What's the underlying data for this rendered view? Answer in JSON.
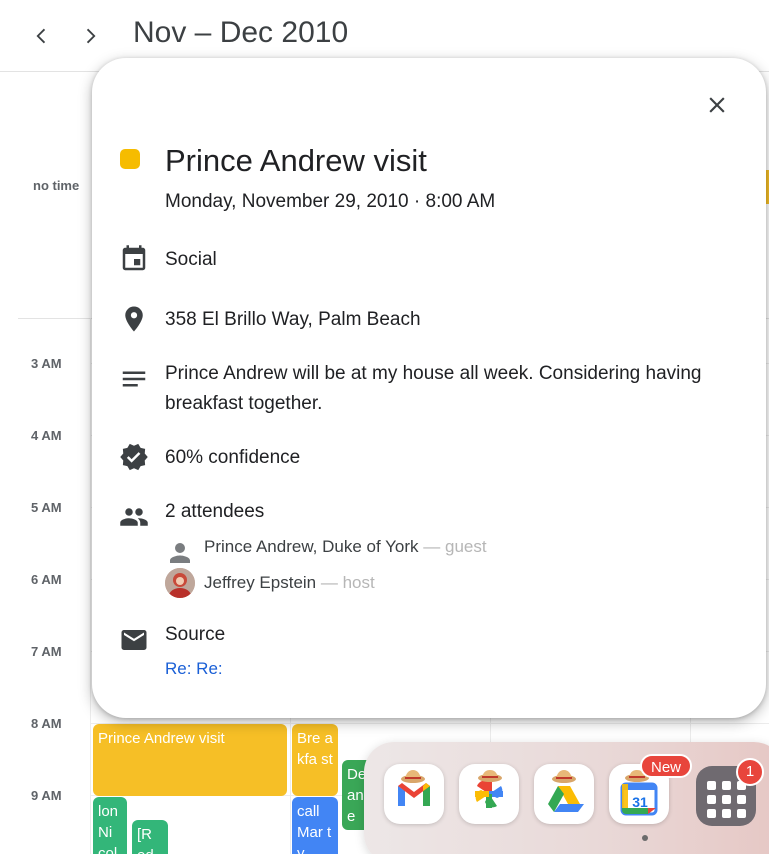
{
  "header": {
    "prev_icon": "chevron-left-icon",
    "next_icon": "chevron-right-icon",
    "range_title": "Nov – Dec 2010"
  },
  "grid": {
    "no_time_label": "no time",
    "hours": [
      "3 AM",
      "4 AM",
      "5 AM",
      "6 AM",
      "7 AM",
      "8 AM",
      "9 AM"
    ],
    "events": [
      {
        "title": "Prince Andrew visit",
        "color": "#f6bf26"
      },
      {
        "title": "Bre akfa st",
        "color": "#f6bf26"
      },
      {
        "title": "De an re",
        "color": "#3aa757"
      },
      {
        "title": "lon Ni col",
        "color": "#33b679"
      },
      {
        "title": "[R ed",
        "color": "#33b679"
      },
      {
        "title": "call Mar ty",
        "color": "#4285f4"
      }
    ]
  },
  "popup": {
    "close_icon": "close-icon",
    "color": "#f6bc00",
    "title": "Prince Andrew visit",
    "when": "Monday, November 29, 2010 · 8:00 AM",
    "calendar": "Social",
    "location": "358 El Brillo Way, Palm Beach",
    "description": "Prince Andrew will be at my house all week. Considering having breakfast together.",
    "confidence": "60% confidence",
    "attendees_label": "2 attendees",
    "guests": [
      {
        "name": "Prince Andrew, Duke of York",
        "role": "— guest"
      },
      {
        "name": "Jeffrey Epstein",
        "role": "— host"
      }
    ],
    "source_label": "Source",
    "source_link": "Re: Re:"
  },
  "dock": {
    "apps": [
      "gmail-app-icon",
      "photos-app-icon",
      "drive-app-icon",
      "calendar-app-icon"
    ],
    "calendar_day": "31",
    "new_badge": "New",
    "launcher_badge": "1"
  }
}
